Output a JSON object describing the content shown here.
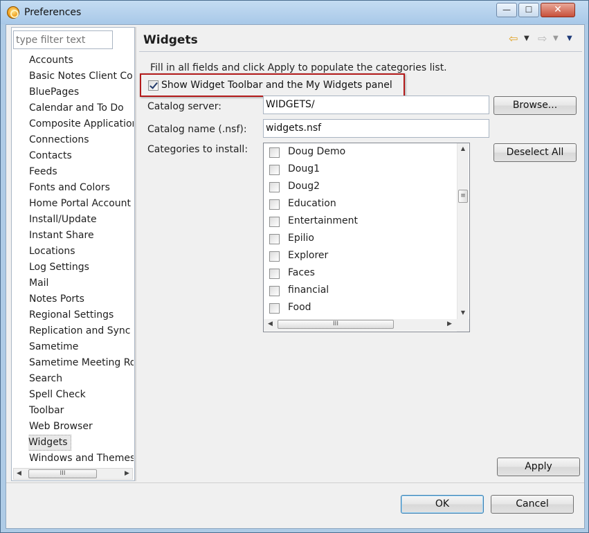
{
  "window": {
    "title": "Preferences",
    "minimize": "—",
    "maximize": "☐",
    "close": "✕"
  },
  "sidebar": {
    "filter_placeholder": "type filter text",
    "items": [
      {
        "label": "Accounts"
      },
      {
        "label": "Basic Notes Client Con"
      },
      {
        "label": "BluePages"
      },
      {
        "label": "Calendar and To Do"
      },
      {
        "label": "Composite Application"
      },
      {
        "label": "Connections"
      },
      {
        "label": "Contacts"
      },
      {
        "label": "Feeds"
      },
      {
        "label": "Fonts and Colors"
      },
      {
        "label": "Home Portal Account"
      },
      {
        "label": "Install/Update"
      },
      {
        "label": "Instant Share"
      },
      {
        "label": "Locations"
      },
      {
        "label": "Log Settings"
      },
      {
        "label": "Mail"
      },
      {
        "label": "Notes Ports"
      },
      {
        "label": "Regional Settings"
      },
      {
        "label": "Replication and Sync"
      },
      {
        "label": "Sametime"
      },
      {
        "label": "Sametime Meeting Ro"
      },
      {
        "label": "Search"
      },
      {
        "label": "Spell Check"
      },
      {
        "label": "Toolbar"
      },
      {
        "label": "Web Browser"
      },
      {
        "label": "Widgets",
        "selected": true
      },
      {
        "label": "Windows and Themes"
      }
    ],
    "scroll_thumb": "III"
  },
  "page": {
    "heading": "Widgets",
    "nav": {
      "back": "⇦",
      "back_menu": "▼",
      "forward": "⇨",
      "forward_menu": "▼",
      "view_menu": "▼"
    },
    "description": "Fill in all fields and click Apply to populate the categories list.",
    "show_toolbar": {
      "label": "Show Widget Toolbar and the My Widgets panel",
      "checked": true
    },
    "catalog_server": {
      "label": "Catalog server:",
      "value": "WIDGETS/",
      "browse": "Browse..."
    },
    "catalog_name": {
      "label": "Catalog name (.nsf):",
      "value": "widgets.nsf"
    },
    "categories": {
      "label": "Categories to install:",
      "deselect": "Deselect All",
      "items": [
        {
          "label": "Doug Demo",
          "checked": false
        },
        {
          "label": "Doug1",
          "checked": false
        },
        {
          "label": "Doug2",
          "checked": false
        },
        {
          "label": "Education",
          "checked": false
        },
        {
          "label": "Entertainment",
          "checked": false
        },
        {
          "label": "Epilio",
          "checked": false
        },
        {
          "label": "Explorer",
          "checked": false
        },
        {
          "label": "Faces",
          "checked": false
        },
        {
          "label": "financial",
          "checked": false
        },
        {
          "label": "Food",
          "checked": false
        }
      ],
      "hscroll_thumb": "III",
      "vscroll_thumb": "≡"
    },
    "apply": "Apply"
  },
  "footer": {
    "ok": "OK",
    "cancel": "Cancel"
  },
  "colors": {
    "highlight_border": "#b31a1a",
    "titlebar": "#a8c8e8",
    "default_button": "#3c7fb1"
  }
}
